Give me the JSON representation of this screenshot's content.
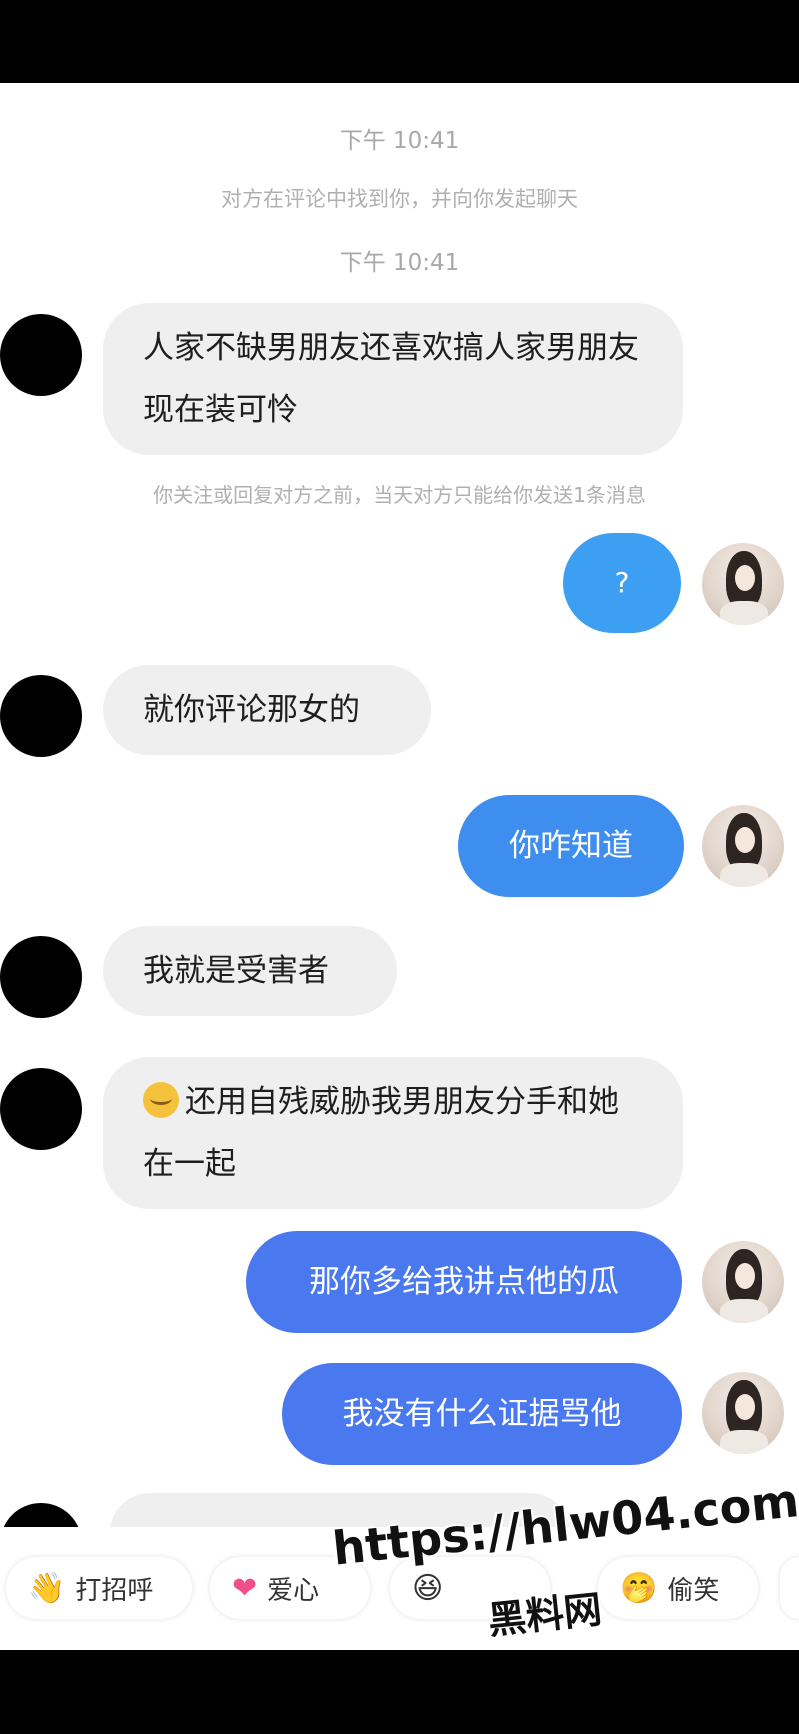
{
  "chat": {
    "timestamp_1": "下午 10:41",
    "system_notice_1": "对方在评论中找到你，并向你发起聊天",
    "timestamp_2": "下午 10:41",
    "system_notice_2": "你关注或回复对方之前，当天对方只能给你发送1条消息",
    "messages": [
      {
        "from": "them",
        "text": "人家不缺男朋友还喜欢搞人家男朋友 现在装可怜"
      },
      {
        "from": "me",
        "text": "?"
      },
      {
        "from": "them",
        "text": "就你评论那女的"
      },
      {
        "from": "me",
        "text": "你咋知道"
      },
      {
        "from": "them",
        "text": "我就是受害者"
      },
      {
        "from": "them",
        "text": "还用自残威胁我男朋友分手和她在一起",
        "emoji": "hand-over-mouth-emoji"
      },
      {
        "from": "me",
        "text": "那你多给我讲点他的瓜"
      },
      {
        "from": "me",
        "text": "我没有什么证据骂他"
      }
    ]
  },
  "quick_replies": [
    {
      "label": "打招呼",
      "icon": "wave-hand-icon"
    },
    {
      "label": "爱心",
      "icon": "heart-icon"
    },
    {
      "label": "",
      "icon": "laugh-face-icon"
    },
    {
      "label": "偷笑",
      "icon": "giggle-face-icon"
    }
  ],
  "watermark": {
    "url": "https://hlw04.com",
    "name": "黑料网"
  },
  "colors": {
    "bubble_in": "#efefef",
    "bubble_out_light": "#3d9ff2",
    "bubble_out_mid": "#3e8ef0",
    "bubble_out_dark": "#4a78ee"
  }
}
